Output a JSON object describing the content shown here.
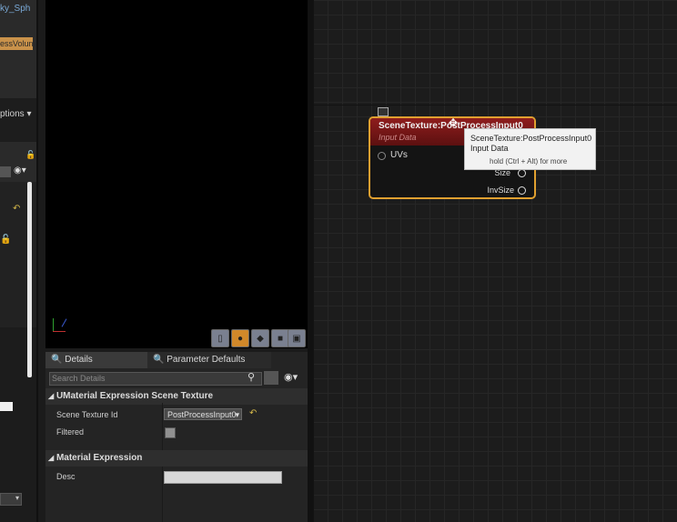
{
  "left_panel": {
    "top_link": "ky_Sph",
    "chip": "essVolun",
    "options_label": "ptions"
  },
  "details": {
    "tabs": [
      "Details",
      "Parameter Defaults"
    ],
    "search_placeholder": "Search Details",
    "sections": {
      "scene_texture": {
        "title": "UMaterial Expression Scene Texture",
        "scene_texture_id_label": "Scene Texture Id",
        "scene_texture_id_value": "PostProcessInput0",
        "filtered_label": "Filtered"
      },
      "material_expression": {
        "title": "Material Expression",
        "desc_label": "Desc"
      }
    }
  },
  "node": {
    "title": "SceneTexture:PostProcessInput0",
    "subtitle": "Input Data",
    "input_pins": [
      "UVs"
    ],
    "output_pins": [
      "Size",
      "InvSize"
    ]
  },
  "tooltip": {
    "line1": "SceneTexture:PostProcessInput0",
    "line2": "Input Data",
    "hint": "hold (Ctrl + Alt) for more"
  },
  "colors": {
    "node_border": "#e0a030",
    "node_header": "#8e1d1d",
    "viewport_button_active": "#d0882a"
  }
}
